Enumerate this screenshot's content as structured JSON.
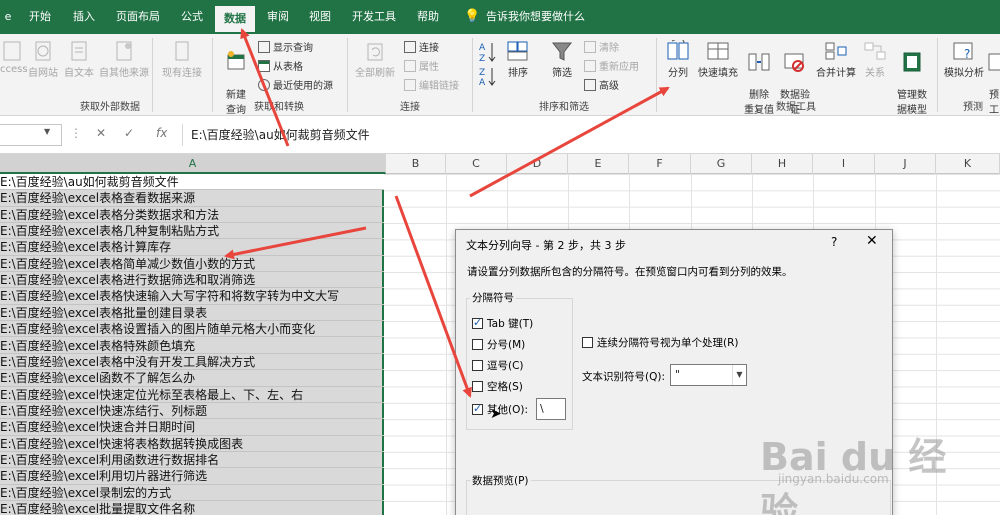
{
  "tabs": [
    {
      "label": "开始",
      "active": false
    },
    {
      "label": "插入",
      "active": false
    },
    {
      "label": "页面布局",
      "active": false
    },
    {
      "label": "公式",
      "active": false
    },
    {
      "label": "数据",
      "active": true
    },
    {
      "label": "审阅",
      "active": false
    },
    {
      "label": "视图",
      "active": false
    },
    {
      "label": "开发工具",
      "active": false
    },
    {
      "label": "帮助",
      "active": false
    }
  ],
  "tell_me": "告诉我你想要做什么",
  "ribbon": {
    "get_external": {
      "label": "获取外部数据",
      "items": [
        "ccess",
        "自网站",
        "自文本",
        "自其他来源",
        "现有连接"
      ]
    },
    "get_transform": {
      "label": "获取和转换",
      "new_query": "新建\n查询",
      "small": [
        "显示查询",
        "从表格",
        "最近使用的源"
      ]
    },
    "connections": {
      "label": "连接",
      "refresh_all": "全部刷新",
      "small": [
        "连接",
        "属性",
        "编辑链接"
      ]
    },
    "sort_filter": {
      "label": "排序和筛选",
      "sort": "排序",
      "filter": "筛选",
      "small": [
        "清除",
        "重新应用",
        "高级"
      ]
    },
    "data_tools": {
      "label": "数据工具",
      "split": "分列",
      "flash_fill": "快速填充",
      "remove_dup": "删除\n重复值",
      "validation": "数据验\n证",
      "consolidate": "合并计算",
      "relations": "关系",
      "data_model": "管理数\n据模型"
    },
    "forecast": {
      "label": "预测",
      "whatif": "模拟分析",
      "forecast_sheet": "预\n工"
    }
  },
  "formula_bar": {
    "value": "E:\\百度经验\\au如何裁剪音频文件"
  },
  "columns": [
    "A",
    "B",
    "C",
    "D",
    "E",
    "F",
    "G",
    "H",
    "I",
    "J",
    "K"
  ],
  "rows": [
    "E:\\百度经验\\au如何裁剪音频文件",
    "E:\\百度经验\\excel表格查看数据来源",
    "E:\\百度经验\\excel表格分类数据求和方法",
    "E:\\百度经验\\excel表格几种复制粘贴方式",
    "E:\\百度经验\\excel表格计算库存",
    "E:\\百度经验\\excel表格简单减少数值小数的方式",
    "E:\\百度经验\\excel表格进行数据筛选和取消筛选",
    "E:\\百度经验\\excel表格快速输入大写字符和将数字转为中文大写",
    "E:\\百度经验\\excel表格批量创建目录表",
    "E:\\百度经验\\excel表格设置插入的图片随单元格大小而变化",
    "E:\\百度经验\\excel表格特殊颜色填充",
    "E:\\百度经验\\excel表格中没有开发工具解决方式",
    "E:\\百度经验\\excel函数不了解怎么办",
    "E:\\百度经验\\excel快速定位光标至表格最上、下、左、右",
    "E:\\百度经验\\excel快速冻结行、列标题",
    "E:\\百度经验\\excel快速合并日期时间",
    "E:\\百度经验\\excel快速将表格数据转换成图表",
    "E:\\百度经验\\excel利用函数进行数据排名",
    "E:\\百度经验\\excel利用切片器进行筛选",
    "E:\\百度经验\\excel录制宏的方式",
    "E:\\百度经验\\excel批量提取文件名称"
  ],
  "dialog": {
    "title": "文本分列向导 - 第 2 步，共 3 步",
    "help": "?",
    "close": "✕",
    "instruction": "请设置分列数据所包含的分隔符号。在预览窗口内可看到分列的效果。",
    "delimiters_legend": "分隔符号",
    "delimiters": [
      {
        "label": "Tab 键(T)",
        "checked": true
      },
      {
        "label": "分号(M)",
        "checked": false
      },
      {
        "label": "逗号(C)",
        "checked": false
      },
      {
        "label": "空格(S)",
        "checked": false
      },
      {
        "label": "其他(O):",
        "checked": true
      }
    ],
    "other_value": "\\",
    "consecutive": "连续分隔符号视为单个处理(R)",
    "consecutive_checked": false,
    "qualifier_label": "文本识别符号(Q):",
    "qualifier_value": "\"",
    "preview_legend": "数据预览(P)"
  },
  "watermark": {
    "main": "Bai du 经验",
    "sub": "jingyan.baidu.com"
  },
  "colors": {
    "accent": "#217346",
    "arrow": "#e8453c"
  }
}
